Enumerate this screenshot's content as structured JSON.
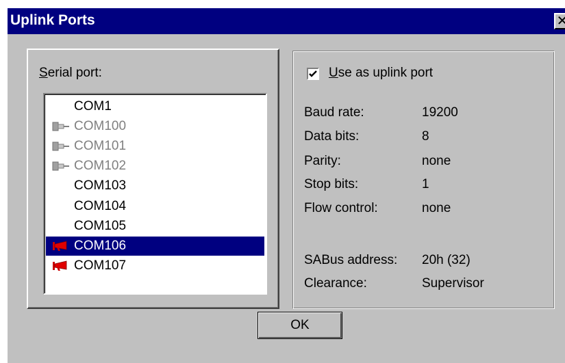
{
  "window": {
    "title": "Uplink Ports",
    "close_glyph": "✕"
  },
  "serial_port": {
    "label_prefix": "S",
    "label_rest": "erial port:",
    "items": [
      {
        "label": "COM1",
        "icon": "",
        "state": "normal"
      },
      {
        "label": "COM100",
        "icon": "plug-icon",
        "state": "disabled"
      },
      {
        "label": "COM101",
        "icon": "plug-icon",
        "state": "disabled"
      },
      {
        "label": "COM102",
        "icon": "plug-icon",
        "state": "disabled"
      },
      {
        "label": "COM103",
        "icon": "",
        "state": "normal"
      },
      {
        "label": "COM104",
        "icon": "",
        "state": "normal"
      },
      {
        "label": "COM105",
        "icon": "",
        "state": "normal"
      },
      {
        "label": "COM106",
        "icon": "megaphone-icon",
        "state": "selected"
      },
      {
        "label": "COM107",
        "icon": "megaphone-icon",
        "state": "normal"
      }
    ]
  },
  "uplink": {
    "checkbox_checked": true,
    "checkbox_label_prefix": "U",
    "checkbox_label_rest": "se as uplink port",
    "fields": [
      {
        "label": "Baud rate:",
        "value": "19200"
      },
      {
        "label": "Data bits:",
        "value": "8"
      },
      {
        "label": "Parity:",
        "value": "none"
      },
      {
        "label": "Stop bits:",
        "value": "1"
      },
      {
        "label": "Flow control:",
        "value": "none"
      },
      {
        "label": "SABus address:",
        "value": "20h (32)"
      },
      {
        "label": "Clearance:",
        "value": "Supervisor"
      }
    ]
  },
  "ok_label": "OK",
  "colors": {
    "titlebar": "#000080",
    "selection": "#000080",
    "face": "#c0c0c0",
    "megaphone": "#cc0000",
    "plug": "#909090"
  }
}
